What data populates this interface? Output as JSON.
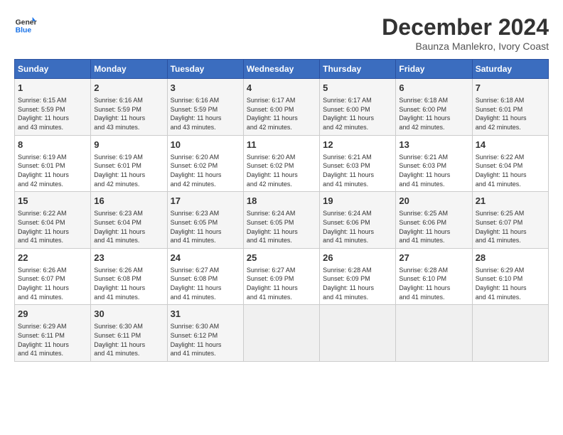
{
  "logo": {
    "line1": "General",
    "line2": "Blue"
  },
  "title": "December 2024",
  "subtitle": "Baunza Manlekro, Ivory Coast",
  "days_header": [
    "Sunday",
    "Monday",
    "Tuesday",
    "Wednesday",
    "Thursday",
    "Friday",
    "Saturday"
  ],
  "weeks": [
    [
      {
        "day": "1",
        "info": "Sunrise: 6:15 AM\nSunset: 5:59 PM\nDaylight: 11 hours\nand 43 minutes."
      },
      {
        "day": "2",
        "info": "Sunrise: 6:16 AM\nSunset: 5:59 PM\nDaylight: 11 hours\nand 43 minutes."
      },
      {
        "day": "3",
        "info": "Sunrise: 6:16 AM\nSunset: 5:59 PM\nDaylight: 11 hours\nand 43 minutes."
      },
      {
        "day": "4",
        "info": "Sunrise: 6:17 AM\nSunset: 6:00 PM\nDaylight: 11 hours\nand 42 minutes."
      },
      {
        "day": "5",
        "info": "Sunrise: 6:17 AM\nSunset: 6:00 PM\nDaylight: 11 hours\nand 42 minutes."
      },
      {
        "day": "6",
        "info": "Sunrise: 6:18 AM\nSunset: 6:00 PM\nDaylight: 11 hours\nand 42 minutes."
      },
      {
        "day": "7",
        "info": "Sunrise: 6:18 AM\nSunset: 6:01 PM\nDaylight: 11 hours\nand 42 minutes."
      }
    ],
    [
      {
        "day": "8",
        "info": "Sunrise: 6:19 AM\nSunset: 6:01 PM\nDaylight: 11 hours\nand 42 minutes."
      },
      {
        "day": "9",
        "info": "Sunrise: 6:19 AM\nSunset: 6:01 PM\nDaylight: 11 hours\nand 42 minutes."
      },
      {
        "day": "10",
        "info": "Sunrise: 6:20 AM\nSunset: 6:02 PM\nDaylight: 11 hours\nand 42 minutes."
      },
      {
        "day": "11",
        "info": "Sunrise: 6:20 AM\nSunset: 6:02 PM\nDaylight: 11 hours\nand 42 minutes."
      },
      {
        "day": "12",
        "info": "Sunrise: 6:21 AM\nSunset: 6:03 PM\nDaylight: 11 hours\nand 41 minutes."
      },
      {
        "day": "13",
        "info": "Sunrise: 6:21 AM\nSunset: 6:03 PM\nDaylight: 11 hours\nand 41 minutes."
      },
      {
        "day": "14",
        "info": "Sunrise: 6:22 AM\nSunset: 6:04 PM\nDaylight: 11 hours\nand 41 minutes."
      }
    ],
    [
      {
        "day": "15",
        "info": "Sunrise: 6:22 AM\nSunset: 6:04 PM\nDaylight: 11 hours\nand 41 minutes."
      },
      {
        "day": "16",
        "info": "Sunrise: 6:23 AM\nSunset: 6:04 PM\nDaylight: 11 hours\nand 41 minutes."
      },
      {
        "day": "17",
        "info": "Sunrise: 6:23 AM\nSunset: 6:05 PM\nDaylight: 11 hours\nand 41 minutes."
      },
      {
        "day": "18",
        "info": "Sunrise: 6:24 AM\nSunset: 6:05 PM\nDaylight: 11 hours\nand 41 minutes."
      },
      {
        "day": "19",
        "info": "Sunrise: 6:24 AM\nSunset: 6:06 PM\nDaylight: 11 hours\nand 41 minutes."
      },
      {
        "day": "20",
        "info": "Sunrise: 6:25 AM\nSunset: 6:06 PM\nDaylight: 11 hours\nand 41 minutes."
      },
      {
        "day": "21",
        "info": "Sunrise: 6:25 AM\nSunset: 6:07 PM\nDaylight: 11 hours\nand 41 minutes."
      }
    ],
    [
      {
        "day": "22",
        "info": "Sunrise: 6:26 AM\nSunset: 6:07 PM\nDaylight: 11 hours\nand 41 minutes."
      },
      {
        "day": "23",
        "info": "Sunrise: 6:26 AM\nSunset: 6:08 PM\nDaylight: 11 hours\nand 41 minutes."
      },
      {
        "day": "24",
        "info": "Sunrise: 6:27 AM\nSunset: 6:08 PM\nDaylight: 11 hours\nand 41 minutes."
      },
      {
        "day": "25",
        "info": "Sunrise: 6:27 AM\nSunset: 6:09 PM\nDaylight: 11 hours\nand 41 minutes."
      },
      {
        "day": "26",
        "info": "Sunrise: 6:28 AM\nSunset: 6:09 PM\nDaylight: 11 hours\nand 41 minutes."
      },
      {
        "day": "27",
        "info": "Sunrise: 6:28 AM\nSunset: 6:10 PM\nDaylight: 11 hours\nand 41 minutes."
      },
      {
        "day": "28",
        "info": "Sunrise: 6:29 AM\nSunset: 6:10 PM\nDaylight: 11 hours\nand 41 minutes."
      }
    ],
    [
      {
        "day": "29",
        "info": "Sunrise: 6:29 AM\nSunset: 6:11 PM\nDaylight: 11 hours\nand 41 minutes."
      },
      {
        "day": "30",
        "info": "Sunrise: 6:30 AM\nSunset: 6:11 PM\nDaylight: 11 hours\nand 41 minutes."
      },
      {
        "day": "31",
        "info": "Sunrise: 6:30 AM\nSunset: 6:12 PM\nDaylight: 11 hours\nand 41 minutes."
      },
      {
        "day": "",
        "info": ""
      },
      {
        "day": "",
        "info": ""
      },
      {
        "day": "",
        "info": ""
      },
      {
        "day": "",
        "info": ""
      }
    ]
  ]
}
